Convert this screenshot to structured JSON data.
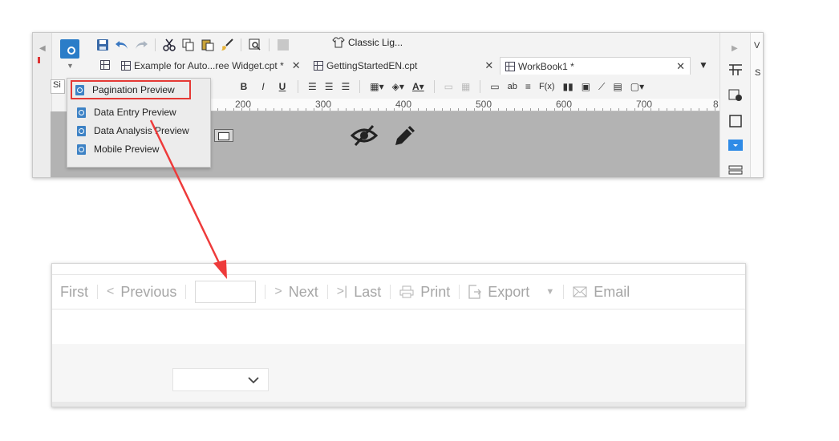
{
  "designer": {
    "classic_button": "Classic Lig...",
    "tabs": [
      {
        "label": "Example for Auto...ree Widget.cpt *"
      },
      {
        "label": "GettingStartedEN.cpt"
      },
      {
        "label": "WorkBook1 *"
      }
    ],
    "font_select": "Si",
    "ruler_labels": [
      "200",
      "300",
      "400",
      "500",
      "600",
      "700",
      "8"
    ],
    "preview_menu": [
      {
        "label": "Pagination Preview"
      },
      {
        "label": "Data Entry Preview"
      },
      {
        "label": "Data Analysis Preview"
      },
      {
        "label": "Mobile Preview"
      }
    ],
    "right_cut_labels": [
      "V",
      "S"
    ]
  },
  "viewer": {
    "pager": {
      "first": "First",
      "previous": "Previous",
      "next": "Next",
      "last": "Last",
      "print": "Print",
      "export": "Export",
      "email": "Email"
    }
  },
  "colors": {
    "accent": "#2b7dc8",
    "highlight": "#e53935",
    "arrow": "#ee3b3b"
  },
  "icons": [
    "preview-icon",
    "save-icon",
    "undo-icon",
    "redo-icon",
    "cut-icon",
    "copy-icon",
    "paste-icon",
    "brush-icon",
    "find-icon",
    "eye-off-icon",
    "pencil-icon",
    "print-icon",
    "export-icon",
    "email-icon",
    "chevron-down-icon"
  ]
}
